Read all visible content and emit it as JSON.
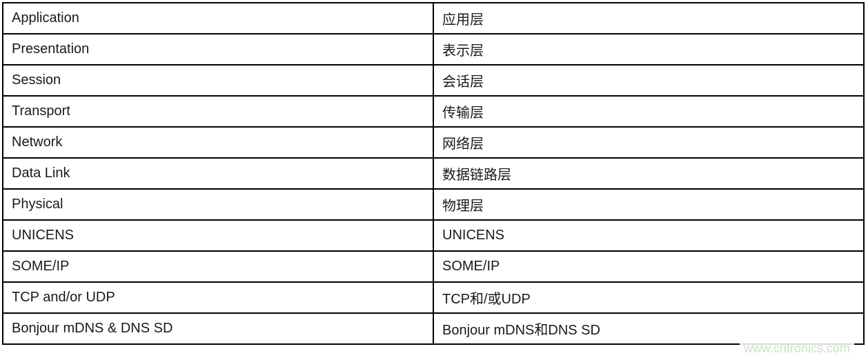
{
  "table": {
    "rows": [
      {
        "en": "Application",
        "zh": "应用层"
      },
      {
        "en": "Presentation",
        "zh": "表示层"
      },
      {
        "en": "Session",
        "zh": "会话层"
      },
      {
        "en": "Transport",
        "zh": "传输层"
      },
      {
        "en": "Network",
        "zh": "网络层"
      },
      {
        "en": "Data Link",
        "zh": "数据链路层"
      },
      {
        "en": "Physical",
        "zh": "物理层"
      },
      {
        "en": "UNICENS",
        "zh": "UNICENS"
      },
      {
        "en": "SOME/IP",
        "zh": "SOME/IP"
      },
      {
        "en": "TCP and/or UDP",
        "zh": "TCP和/或UDP"
      },
      {
        "en": "Bonjour mDNS & DNS SD",
        "zh": "Bonjour mDNS和DNS SD"
      }
    ]
  },
  "watermark": "www.cntronics.com"
}
